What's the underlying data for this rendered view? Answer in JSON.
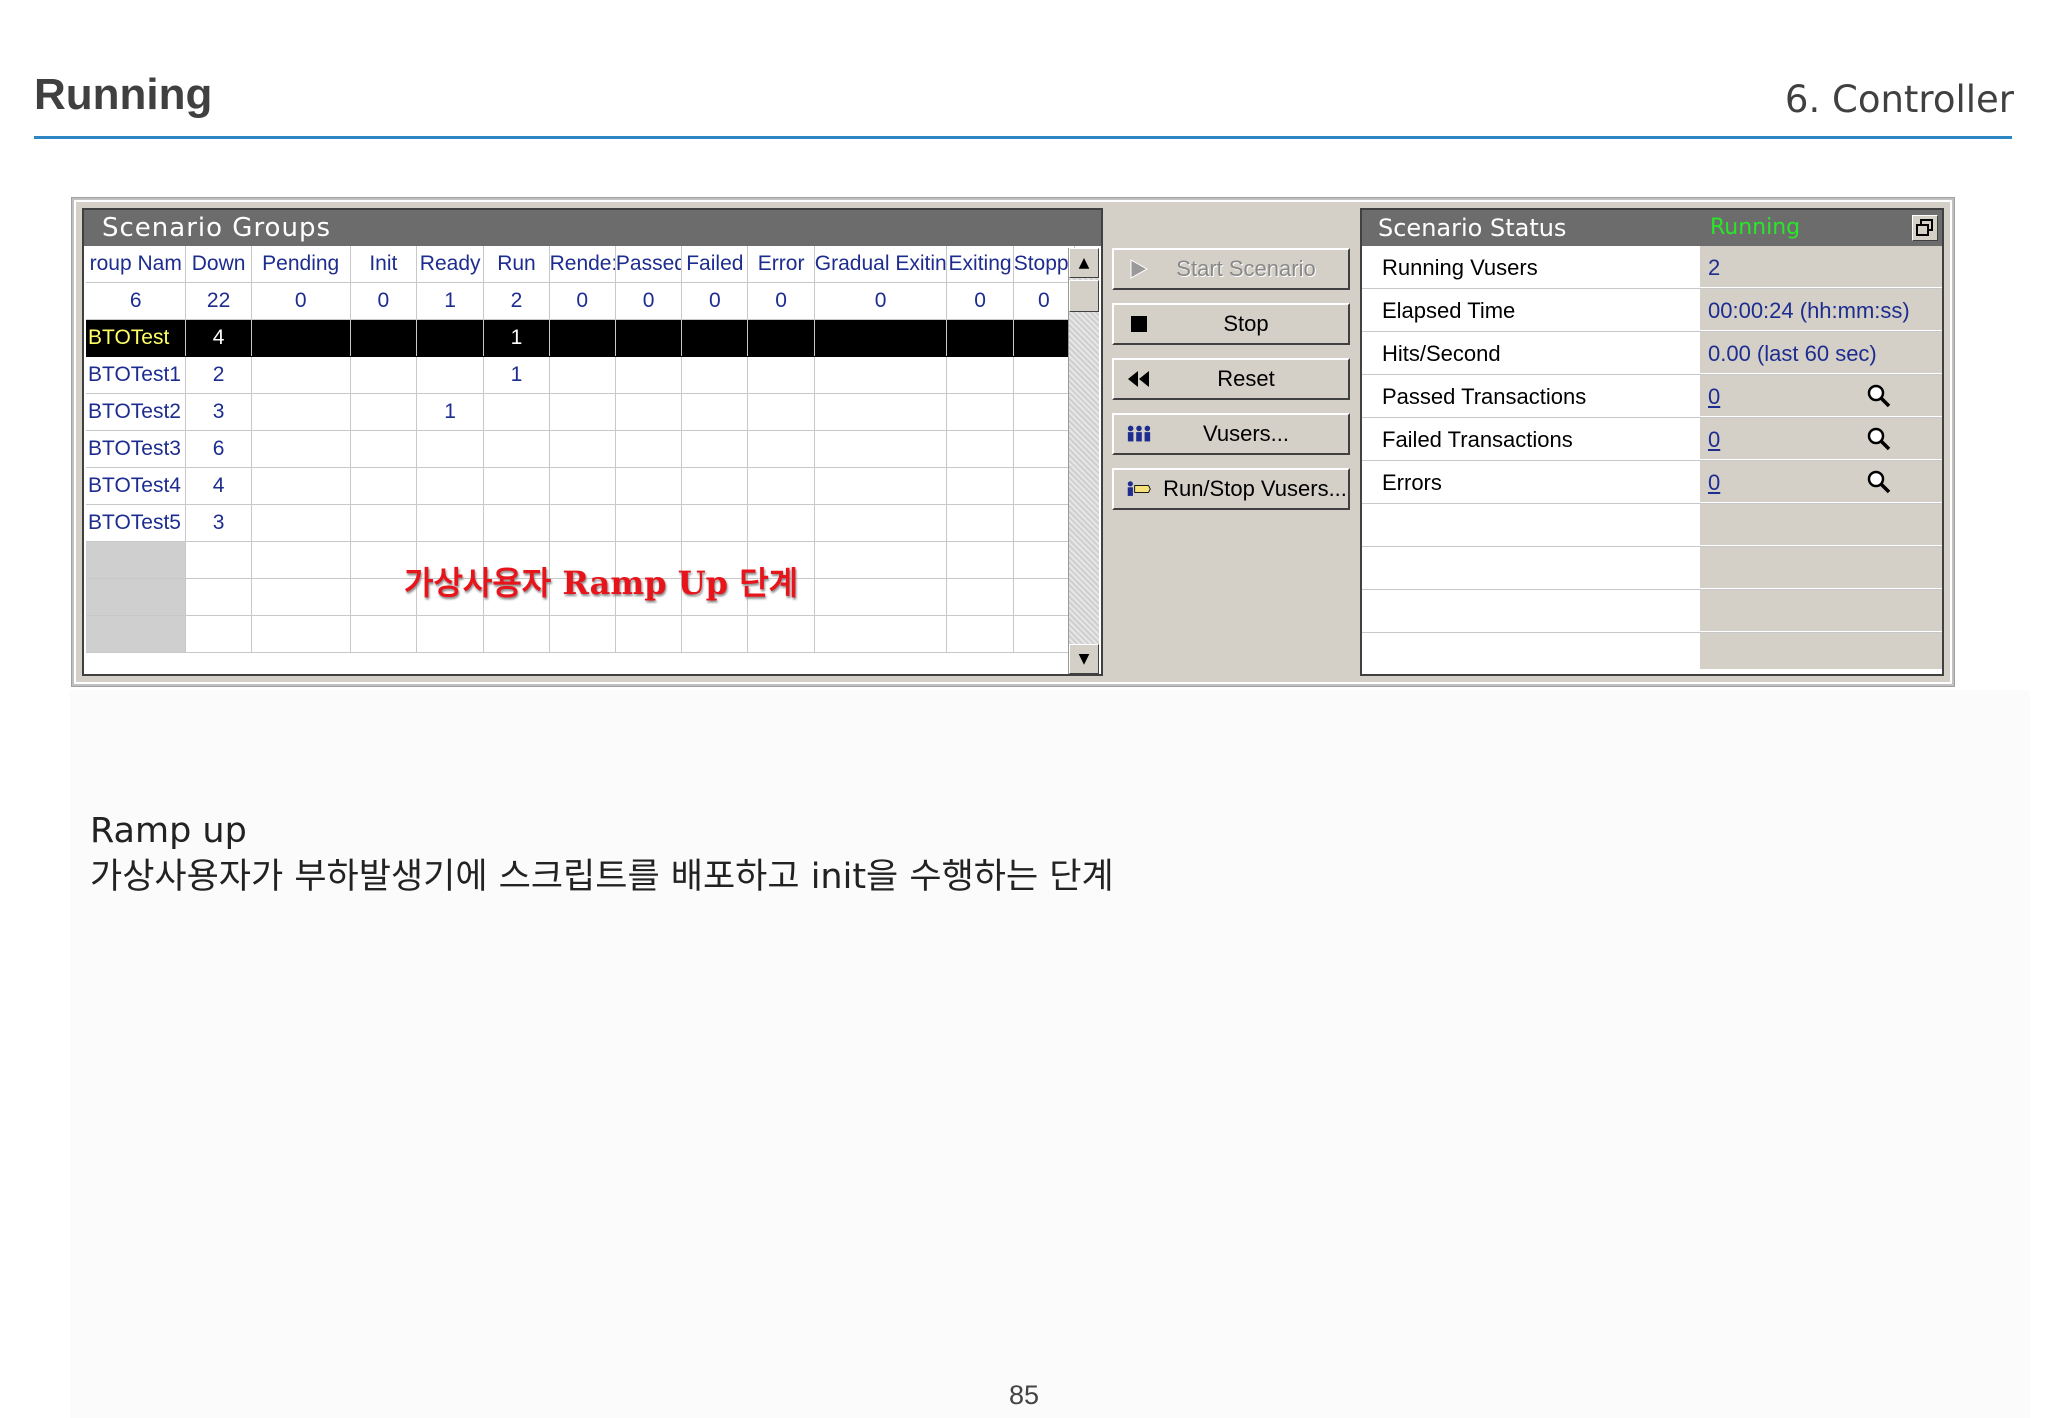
{
  "header": {
    "title": "Running",
    "section": "6. Controller"
  },
  "groups": {
    "title": "Scenario Groups",
    "columns": [
      "roup Nam",
      "Down",
      "Pending",
      "Init",
      "Ready",
      "Run",
      "Rende:",
      "Passed",
      "Failed",
      "Error",
      "Gradual Exiting",
      "Exiting",
      "Stopped"
    ],
    "totals": [
      "6",
      "22",
      "0",
      "0",
      "1",
      "2",
      "0",
      "0",
      "0",
      "0",
      "0",
      "0",
      "0"
    ],
    "rows": [
      {
        "name": "BTOTest",
        "down": "4",
        "ready": "",
        "run": "1"
      },
      {
        "name": "BTOTest1",
        "down": "2",
        "ready": "",
        "run": "1"
      },
      {
        "name": "BTOTest2",
        "down": "3",
        "ready": "1",
        "run": ""
      },
      {
        "name": "BTOTest3",
        "down": "6",
        "ready": "",
        "run": ""
      },
      {
        "name": "BTOTest4",
        "down": "4",
        "ready": "",
        "run": ""
      },
      {
        "name": "BTOTest5",
        "down": "3",
        "ready": "",
        "run": ""
      }
    ],
    "overlay_note": "가상사용자 Ramp Up 단계"
  },
  "buttons": {
    "start": "Start Scenario",
    "stop": "Stop",
    "reset": "Reset",
    "vusers": "Vusers...",
    "runstop": "Run/Stop Vusers..."
  },
  "status": {
    "title": "Scenario Status",
    "state": "Running",
    "rows": [
      {
        "label": "Running Vusers",
        "value": "2"
      },
      {
        "label": "Elapsed Time",
        "value": "00:00:24 (hh:mm:ss)"
      },
      {
        "label": "Hits/Second",
        "value": "0.00 (last 60 sec)"
      },
      {
        "label": "Passed Transactions",
        "value": "0"
      },
      {
        "label": "Failed Transactions",
        "value": "0"
      },
      {
        "label": "Errors",
        "value": "0"
      }
    ]
  },
  "caption": {
    "line1": "Ramp up",
    "line2": "가상사용자가 부하발생기에 스크립트를 배포하고 init을 수행하는 단계"
  },
  "page_number": "85",
  "colors": {
    "accent_rule": "#2c86c4",
    "status_running": "#29e629",
    "note_red": "#e8141b",
    "grid_text": "#1d2c8f"
  }
}
